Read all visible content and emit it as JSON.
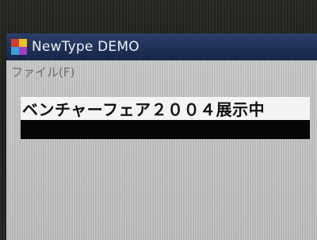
{
  "window": {
    "title": "NewType DEMO",
    "icon": "app-icon"
  },
  "menu": {
    "items": [
      {
        "label": "ファイル(F)"
      }
    ]
  },
  "content": {
    "banner_text": "ベンチャーフェア２００４展示中",
    "input_value": ""
  }
}
